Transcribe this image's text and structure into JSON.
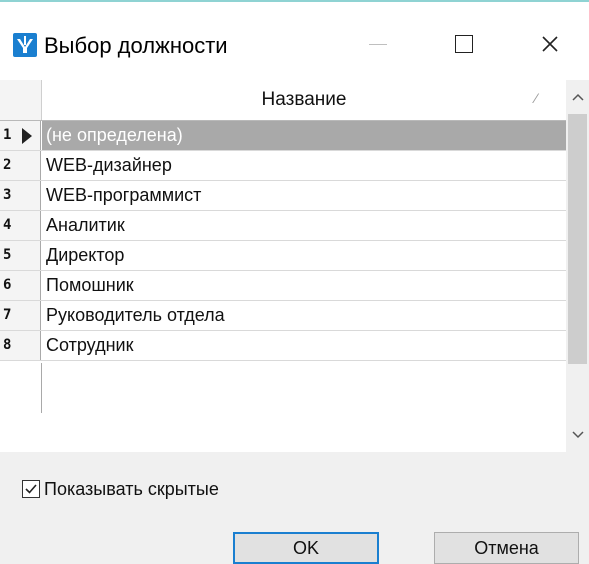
{
  "window": {
    "title": "Выбор должности",
    "controls": {
      "minimize": "minimize",
      "maximize": "maximize",
      "close": "close"
    },
    "accent_color": "#1a7fd0"
  },
  "table": {
    "column_header": "Название",
    "sort_indicator": "⁄",
    "rows": [
      {
        "index": "1",
        "name": "(не определена)",
        "selected": true
      },
      {
        "index": "2",
        "name": "WEB-дизайнер"
      },
      {
        "index": "3",
        "name": "WEB-программист"
      },
      {
        "index": "4",
        "name": "Аналитик"
      },
      {
        "index": "5",
        "name": "Директор"
      },
      {
        "index": "6",
        "name": "Помошник"
      },
      {
        "index": "7",
        "name": "Руководитель отдела"
      },
      {
        "index": "8",
        "name": "Сотрудник"
      }
    ]
  },
  "options": {
    "show_hidden_label": "Показывать скрытые",
    "show_hidden_checked": true
  },
  "buttons": {
    "ok_label": "OK",
    "cancel_label": "Отмена"
  }
}
